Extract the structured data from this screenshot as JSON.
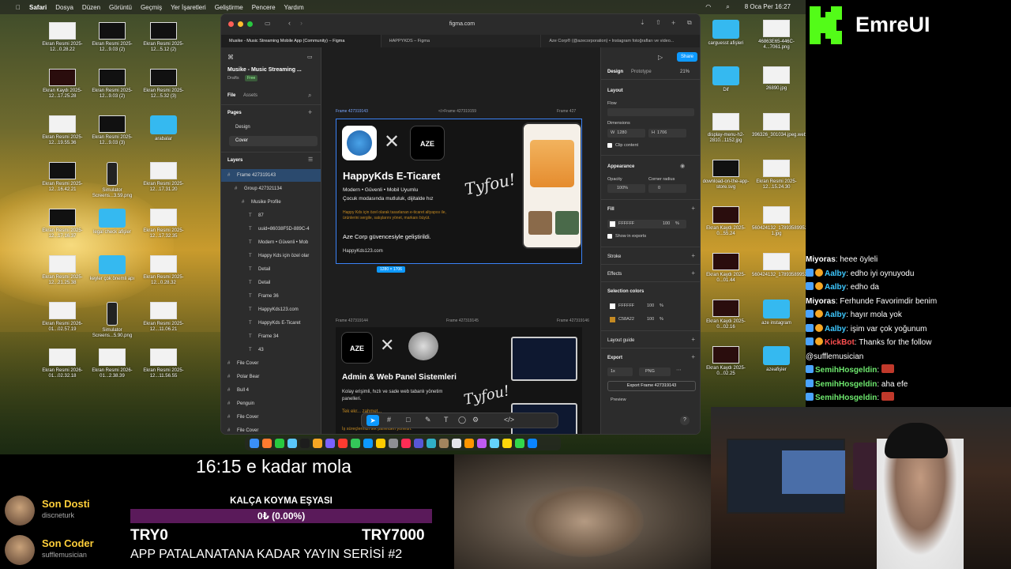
{
  "menubar": {
    "app": "Safari",
    "items": [
      "Dosya",
      "Düzen",
      "Görüntü",
      "Geçmiş",
      "Yer İşaretleri",
      "Geliştirme",
      "Pencere",
      "Yardım"
    ],
    "clock": "8 Oca Per  16:27"
  },
  "desktop_left_icons": [
    {
      "label": "Ekran Resmi 2025-12...0.28.22",
      "kind": "w"
    },
    {
      "label": "Ekran Resmi 2025-12...9.03 (2)",
      "kind": "b"
    },
    {
      "label": "Ekran Resmi 2025-12...5.12 (2)",
      "kind": "b"
    },
    {
      "label": "Ekran Kaydı 2025-12...17.25.28",
      "kind": "m"
    },
    {
      "label": "Ekran Resmi 2025-12...9.03 (2)",
      "kind": "b"
    },
    {
      "label": "Ekran Resmi 2025-12...5.32 (3)",
      "kind": "b"
    },
    {
      "label": "Ekran Resmi 2025-12...19.55.36",
      "kind": "w"
    },
    {
      "label": "Ekran Resmi 2025-12...9.03 (3)",
      "kind": "b"
    },
    {
      "label": "arabalar",
      "kind": "f"
    },
    {
      "label": "Ekran Resmi 2025-12...16.42.21",
      "kind": "b"
    },
    {
      "label": "Simulator Screens...3.59.png",
      "kind": "p"
    },
    {
      "label": "Ekran Resmi 2025-12...17.31.20",
      "kind": "w"
    },
    {
      "label": "Ekran Resmi 2025-12...17.16.37",
      "kind": "b"
    },
    {
      "label": "legal check afişler",
      "kind": "f"
    },
    {
      "label": "Ekran Resmi 2025-12...17.32.35",
      "kind": "w"
    },
    {
      "label": "Ekran Resmi 2025-12...21.25.38",
      "kind": "w"
    },
    {
      "label": "keyler çok önemli apı",
      "kind": "f"
    },
    {
      "label": "Ekran Resmi 2025-12...0.28.32",
      "kind": "w"
    },
    {
      "label": "Ekran Resmi 2026-01...02.57.19",
      "kind": "w"
    },
    {
      "label": "Simulator Screens...5.90.png",
      "kind": "p"
    },
    {
      "label": "Ekran Resmi 2025-12...11.06.21",
      "kind": "w"
    },
    {
      "label": "Ekran Resmi 2026-01...02.32.18",
      "kind": "w"
    },
    {
      "label": "Ekran Resmi 2026-01...2.38.39",
      "kind": "w"
    },
    {
      "label": "Ekran Resmi 2025-12...11.56.55",
      "kind": "w"
    }
  ],
  "desktop_right_icons": [
    {
      "label": "carguesst afişleri",
      "kind": "f"
    },
    {
      "label": "46863E65-446C-4...7061.png",
      "kind": "w"
    },
    {
      "label": "Dif",
      "kind": "f"
    },
    {
      "label": "26890.jpg",
      "kind": "w"
    },
    {
      "label": "display-menu-h2-2810...1152.jpg",
      "kind": "w"
    },
    {
      "label": "396326_301034.jpeg.webp",
      "kind": "w"
    },
    {
      "label": "download-on-the-app-store.svg",
      "kind": "b"
    },
    {
      "label": "Ekran Resmi 2025-12...15.24.30",
      "kind": "w"
    },
    {
      "label": "Ekran Kaydı 2025-0...55.24",
      "kind": "m"
    },
    {
      "label": "560424132_17893589952...5_n-1.jpg",
      "kind": "w"
    },
    {
      "label": "Ekran Kaydı 2025-0...01.44",
      "kind": "m"
    },
    {
      "label": "560424132_17893589952...6_n.jpg",
      "kind": "w"
    },
    {
      "label": "Ekran Kaydı 2025-0...02.16",
      "kind": "m"
    },
    {
      "label": "aze instagram",
      "kind": "f"
    },
    {
      "label": "Ekran Kaydı 2025-0...02.25",
      "kind": "m"
    },
    {
      "label": "azeafişler",
      "kind": "f"
    }
  ],
  "browser": {
    "url": "figma.com",
    "tabs": [
      "Musike - Music Streaming Mobile App (Community) – Figma",
      "HAPPYKDS – Figma",
      "Aze Corp® (@azecorporation) • Instagram fotoğrafları ve video..."
    ]
  },
  "figma": {
    "file_title": "Musike - Music Streaming ...",
    "drafts": "Drafts",
    "plan_badge": "Free",
    "tabs": [
      "File",
      "Assets"
    ],
    "pages_heading": "Pages",
    "pages": [
      "Design",
      "Cover"
    ],
    "layers_heading": "Layers",
    "layers": [
      {
        "name": "Frame 427319143",
        "indent": 0,
        "selected": true
      },
      {
        "name": "Group 427321134",
        "indent": 1
      },
      {
        "name": "Musike Profile",
        "indent": 2
      },
      {
        "name": "87",
        "indent": 3
      },
      {
        "name": "uuid=86038F5D-889C-4",
        "indent": 3
      },
      {
        "name": "Modern • Güvenli • Mob",
        "indent": 3
      },
      {
        "name": "Happy Kds için özel olar",
        "indent": 3
      },
      {
        "name": "Detail",
        "indent": 3
      },
      {
        "name": "Detail",
        "indent": 3
      },
      {
        "name": "Frame 36",
        "indent": 3
      },
      {
        "name": "HappyKds123.com",
        "indent": 3
      },
      {
        "name": "HappyKds E-Ticaret",
        "indent": 3
      },
      {
        "name": "Frame 34",
        "indent": 3
      },
      {
        "name": "43",
        "indent": 3
      },
      {
        "name": "File Cover",
        "indent": 0
      },
      {
        "name": "Polar Bear",
        "indent": 0
      },
      {
        "name": "Bull 4",
        "indent": 0
      },
      {
        "name": "Penguin",
        "indent": 0
      },
      {
        "name": "File Cover",
        "indent": 0
      },
      {
        "name": "File Cover",
        "indent": 0
      }
    ],
    "canvas": {
      "frame_labels_top": [
        "Frame 427319143",
        "</>Frame 427319159",
        "Frame 427"
      ],
      "frame_labels_mid": [
        "Frame 427319144",
        "Frame 427319145",
        "Frame 427319146"
      ],
      "size_badge": "1280 × 1706",
      "card1": {
        "brand": "AZE",
        "title": "HappyKds E-Ticaret",
        "subtitle1": "Modern • Güvenli • Mobil Uyumlu",
        "subtitle2": "Çocuk modasında mutluluk, dijitalde hız",
        "body": "Happy Kds için özel olarak tasarlanan e-ticaret altyapısı ile, ürünlerini sergile, satışlarını yönet, markanı büyüt.",
        "tagline": "Aze Corp güvencesiyle geliştirildi.",
        "site": "HappyKds123.com",
        "signature": "Tyfou!"
      },
      "card2": {
        "brand": "AZE",
        "title": "Admin & Web Panel Sistemleri",
        "body": "Kolay erişimli, hızlı ve sade web tabanlı yönetim panelleri.",
        "accent_text": "Tek ekr... zahmet...",
        "footer": "İş süreçlerinizi tek panelden yönetin.",
        "signature": "Tyfou!"
      }
    },
    "right": {
      "share": "Share",
      "tabs": [
        "Design",
        "Prototype"
      ],
      "zoom": "21%",
      "layout_heading": "Layout",
      "flow": "Flow",
      "dimensions": "Dimensions",
      "w_label": "W",
      "w_value": "1280",
      "h_label": "H",
      "h_value": "1706",
      "clip": "Clip content",
      "appearance": "Appearance",
      "opacity_label": "Opacity",
      "opacity_value": "100%",
      "radius_label": "Corner radius",
      "radius_value": "0",
      "fill_heading": "Fill",
      "fill_hex": "FFFFFF",
      "fill_pct": "100",
      "pct_sign": "%",
      "show_exports": "Show in exports",
      "stroke": "Stroke",
      "effects": "Effects",
      "selection_colors": "Selection colors",
      "sel_colors": [
        {
          "hex": "FFFFFF",
          "pct": "100",
          "swatch": "#ffffff"
        },
        {
          "hex": "C58A22",
          "pct": "100",
          "swatch": "#c58a22"
        }
      ],
      "layout_guide": "Layout guide",
      "export_heading": "Export",
      "export_scale": "1x",
      "export_format": "PNG",
      "export_button": "Export Frame 427319143",
      "preview": "Preview",
      "help": "?"
    }
  },
  "stream": {
    "logo_text": "EmreUI",
    "break_text": "16:15 e kadar mola",
    "goal_title": "KALÇA KOYMA EŞYASI",
    "goal_progress_text": "0₺ (0.00%)",
    "goal_progress": 0,
    "goal_min": "TRY0",
    "goal_max": "TRY7000",
    "series_title": "APP PATALANATANA KADAR YAYIN SERİSİ #2",
    "supporters": [
      {
        "name": "Son Dosti",
        "sub": "discneturk"
      },
      {
        "name": "Son Coder",
        "sub": "sufflemusician"
      }
    ],
    "chat": [
      {
        "user": "Miyoras",
        "text": "heee öyleli",
        "badges": 0,
        "color": "u"
      },
      {
        "user": "Aalby",
        "text": "edho iyi oynuyodu",
        "badges": 2,
        "color": "ub"
      },
      {
        "user": "Aalby",
        "text": "edho da",
        "badges": 2,
        "color": "ub"
      },
      {
        "user": "Miyoras",
        "text": "Ferhunde Favorimdir benim",
        "badges": 0,
        "color": "u"
      },
      {
        "user": "Aalby",
        "text": "hayır mola yok",
        "badges": 2,
        "color": "ub"
      },
      {
        "user": "Aalby",
        "text": "işim var çok yoğunum",
        "badges": 2,
        "color": "ub"
      },
      {
        "user": "KickBot",
        "text": "Thanks for the follow",
        "badges": 2,
        "color": "ur"
      },
      {
        "user": "",
        "text": "@sufflemusician",
        "badges": 0,
        "color": "u"
      },
      {
        "user": "SemihHosgeldin",
        "text": "",
        "badges": 1,
        "color": "ug"
      },
      {
        "user": "SemihHosgeldin",
        "text": "aha efe",
        "badges": 1,
        "color": "ug"
      },
      {
        "user": "SemihHosgeldin",
        "text": "",
        "badges": 1,
        "color": "ug"
      }
    ]
  },
  "colors": {
    "kick_green": "#53fc18",
    "figma_blue": "#0d99ff",
    "gold": "#c58a22",
    "goal_bar": "#6a1b6a"
  }
}
